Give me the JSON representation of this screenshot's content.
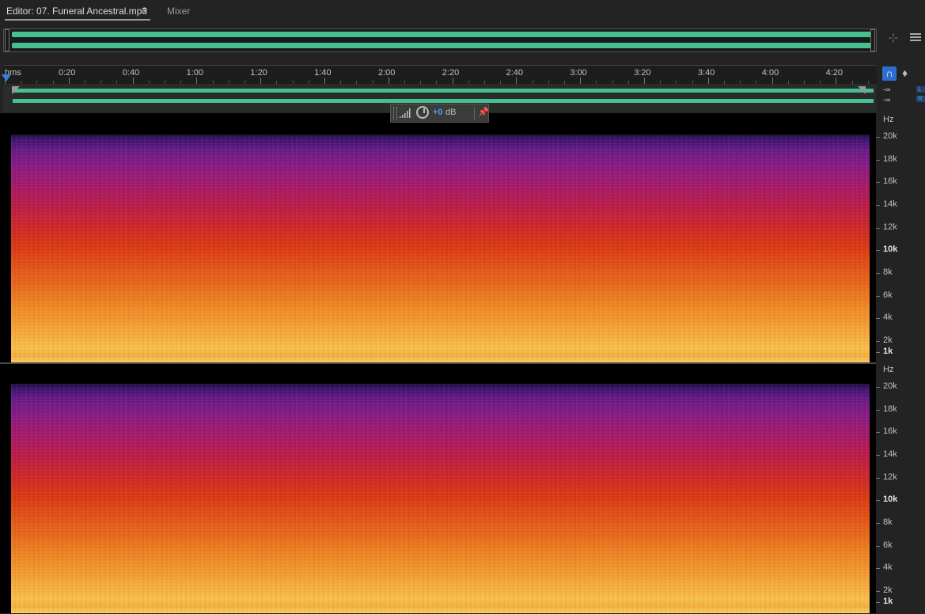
{
  "tabs": {
    "editor_label": "Editor: 07. Funeral Ancestral.mp3",
    "menu_icon": "≡",
    "mixer_label": "Mixer"
  },
  "ruler": {
    "unit_label": "hms",
    "time_labels": [
      "0:20",
      "0:40",
      "1:00",
      "1:20",
      "1:40",
      "2:00",
      "2:20",
      "2:40",
      "3:00",
      "3:20",
      "3:40",
      "4:00",
      "4:20"
    ]
  },
  "volume": {
    "db_top": "-∞",
    "db_bottom": "-∞",
    "flag_top": "L",
    "flag_bottom": "R"
  },
  "hud": {
    "value": "+0",
    "unit": "dB",
    "pin_icon": "pin-icon"
  },
  "frequency_axis": {
    "unit": "Hz",
    "labels": [
      "20k",
      "18k",
      "16k",
      "14k",
      "12k",
      "10k",
      "8k",
      "6k",
      "4k",
      "2k",
      "1k"
    ],
    "emphasized": [
      "10k",
      "1k"
    ]
  },
  "colors": {
    "waveform": "#45c08e",
    "accent": "#2d6fd1",
    "hud_value": "#4d9bf0",
    "playhead": "#3d7ed8"
  },
  "icons": {
    "snap": "magnet-icon",
    "marker": "marker-icon",
    "zoom": "zoom-selection-icon",
    "panel_menu": "panel-menu-icon"
  }
}
